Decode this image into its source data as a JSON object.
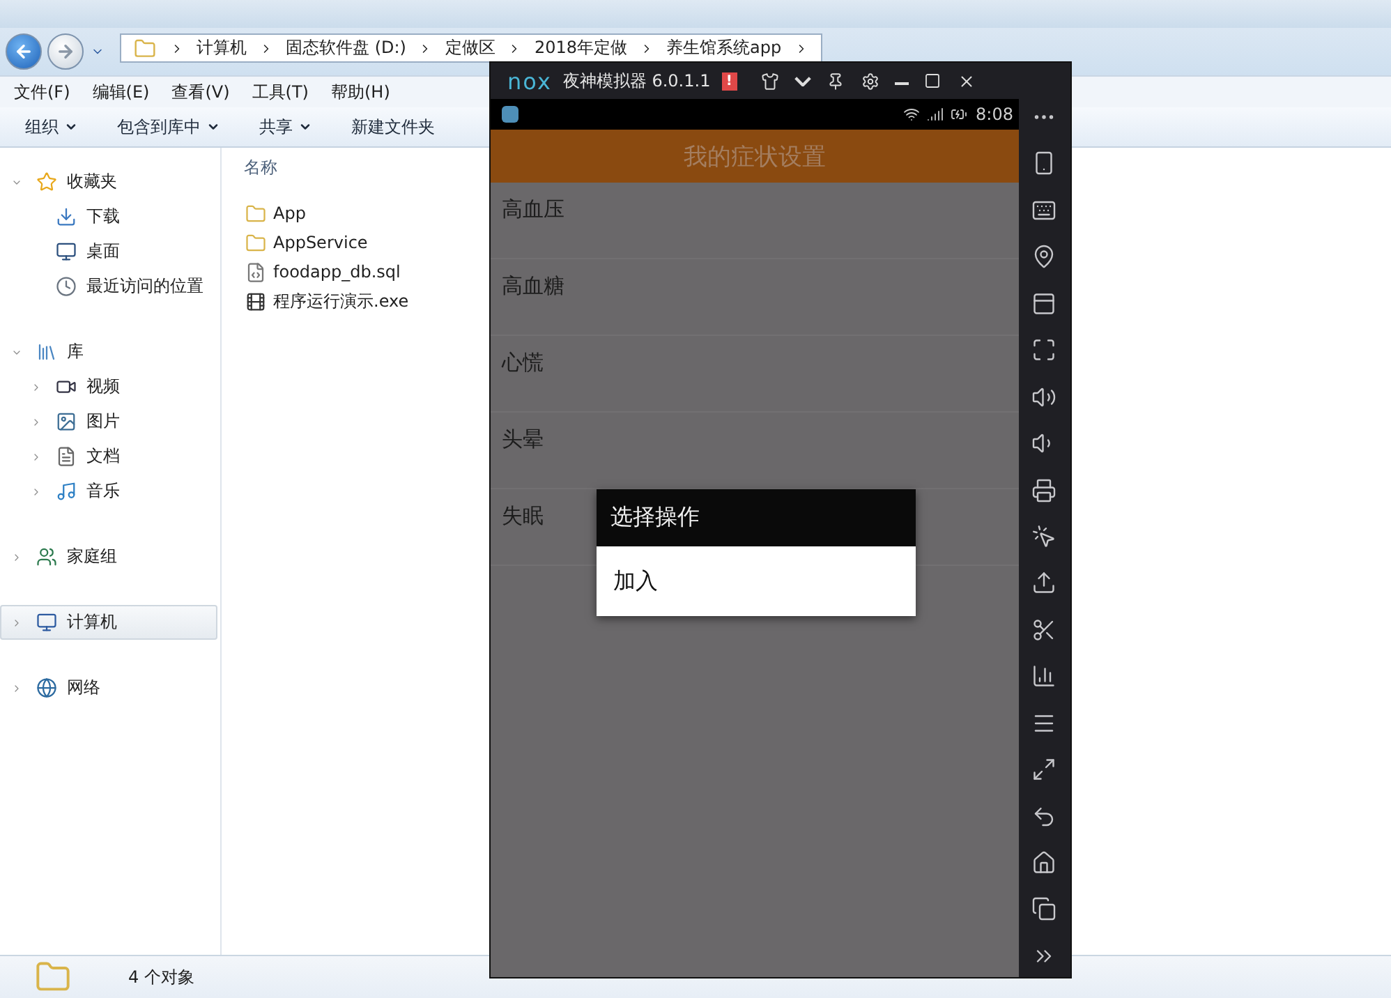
{
  "explorer": {
    "address_path": [
      "计算机",
      "固态软件盘 (D:)",
      "定做区",
      "2018年定做",
      "养生馆系统app"
    ],
    "menu": [
      "文件(F)",
      "编辑(E)",
      "查看(V)",
      "工具(T)",
      "帮助(H)"
    ],
    "toolbar": [
      {
        "label": "组织",
        "dropdown": true
      },
      {
        "label": "包含到库中",
        "dropdown": true
      },
      {
        "label": "共享",
        "dropdown": true
      },
      {
        "label": "新建文件夹",
        "dropdown": false
      }
    ],
    "nav": [
      {
        "label": "收藏夹",
        "kind": "star",
        "expanded": true,
        "selected": false,
        "children": [
          {
            "label": "下载",
            "kind": "download",
            "selected": false
          },
          {
            "label": "桌面",
            "kind": "desktop",
            "selected": false
          },
          {
            "label": "最近访问的位置",
            "kind": "recent",
            "selected": false
          }
        ]
      },
      {
        "label": "库",
        "kind": "library",
        "expanded": true,
        "selected": false,
        "children": [
          {
            "label": "视频",
            "kind": "video",
            "selected": false
          },
          {
            "label": "图片",
            "kind": "picture",
            "selected": false
          },
          {
            "label": "文档",
            "kind": "document",
            "selected": false
          },
          {
            "label": "音乐",
            "kind": "music",
            "selected": false
          }
        ]
      },
      {
        "label": "家庭组",
        "kind": "homegroup",
        "expanded": false,
        "selected": false
      },
      {
        "label": "计算机",
        "kind": "computer",
        "expanded": false,
        "selected": true
      },
      {
        "label": "网络",
        "kind": "network",
        "expanded": false,
        "selected": false
      }
    ],
    "column": "名称",
    "files": [
      {
        "name": "App",
        "kind": "folder"
      },
      {
        "name": "AppService",
        "kind": "folder"
      },
      {
        "name": "foodapp_db.sql",
        "kind": "file"
      },
      {
        "name": "程序运行演示.exe",
        "kind": "exe"
      }
    ],
    "status": "4 个对象"
  },
  "emulator": {
    "logo": "nox",
    "title": "夜神模拟器 6.0.1.1",
    "alert": "!",
    "clock": "8:08",
    "app_title": "我的症状设置",
    "items": [
      "高血压",
      "高血糖",
      "心慌",
      "头晕",
      "失眠"
    ],
    "dialog": {
      "title": "选择操作",
      "options": [
        "加入"
      ]
    }
  }
}
